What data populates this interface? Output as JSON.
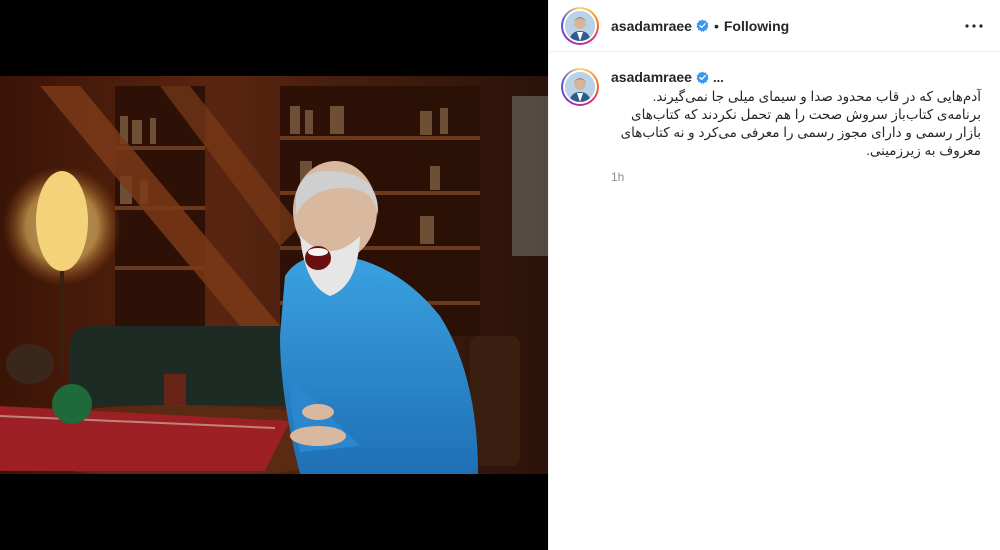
{
  "post": {
    "username": "asadamraee",
    "follow_status": "Following",
    "separator": "•",
    "caption_username": "asadamraee",
    "caption_more": "...",
    "caption_text": "آدم‌هایی که در قاب محدود صدا و سیمای میلی جا نمی‌گیرند. برنامه‌ی کتاب‌باز سروش صحت را هم تحمل نکردند که کتاب‌های بازار رسمی و دارای مجوز رسمی را معرفی می‌کرد و نه کتاب‌های معروف به زیرزمینی.",
    "time": "1h"
  },
  "icons": {
    "verified": "verified-badge-icon",
    "more": "more-options-icon"
  },
  "colors": {
    "verified_blue": "#3897f0",
    "text": "#262626",
    "muted": "#8e8e8e"
  }
}
